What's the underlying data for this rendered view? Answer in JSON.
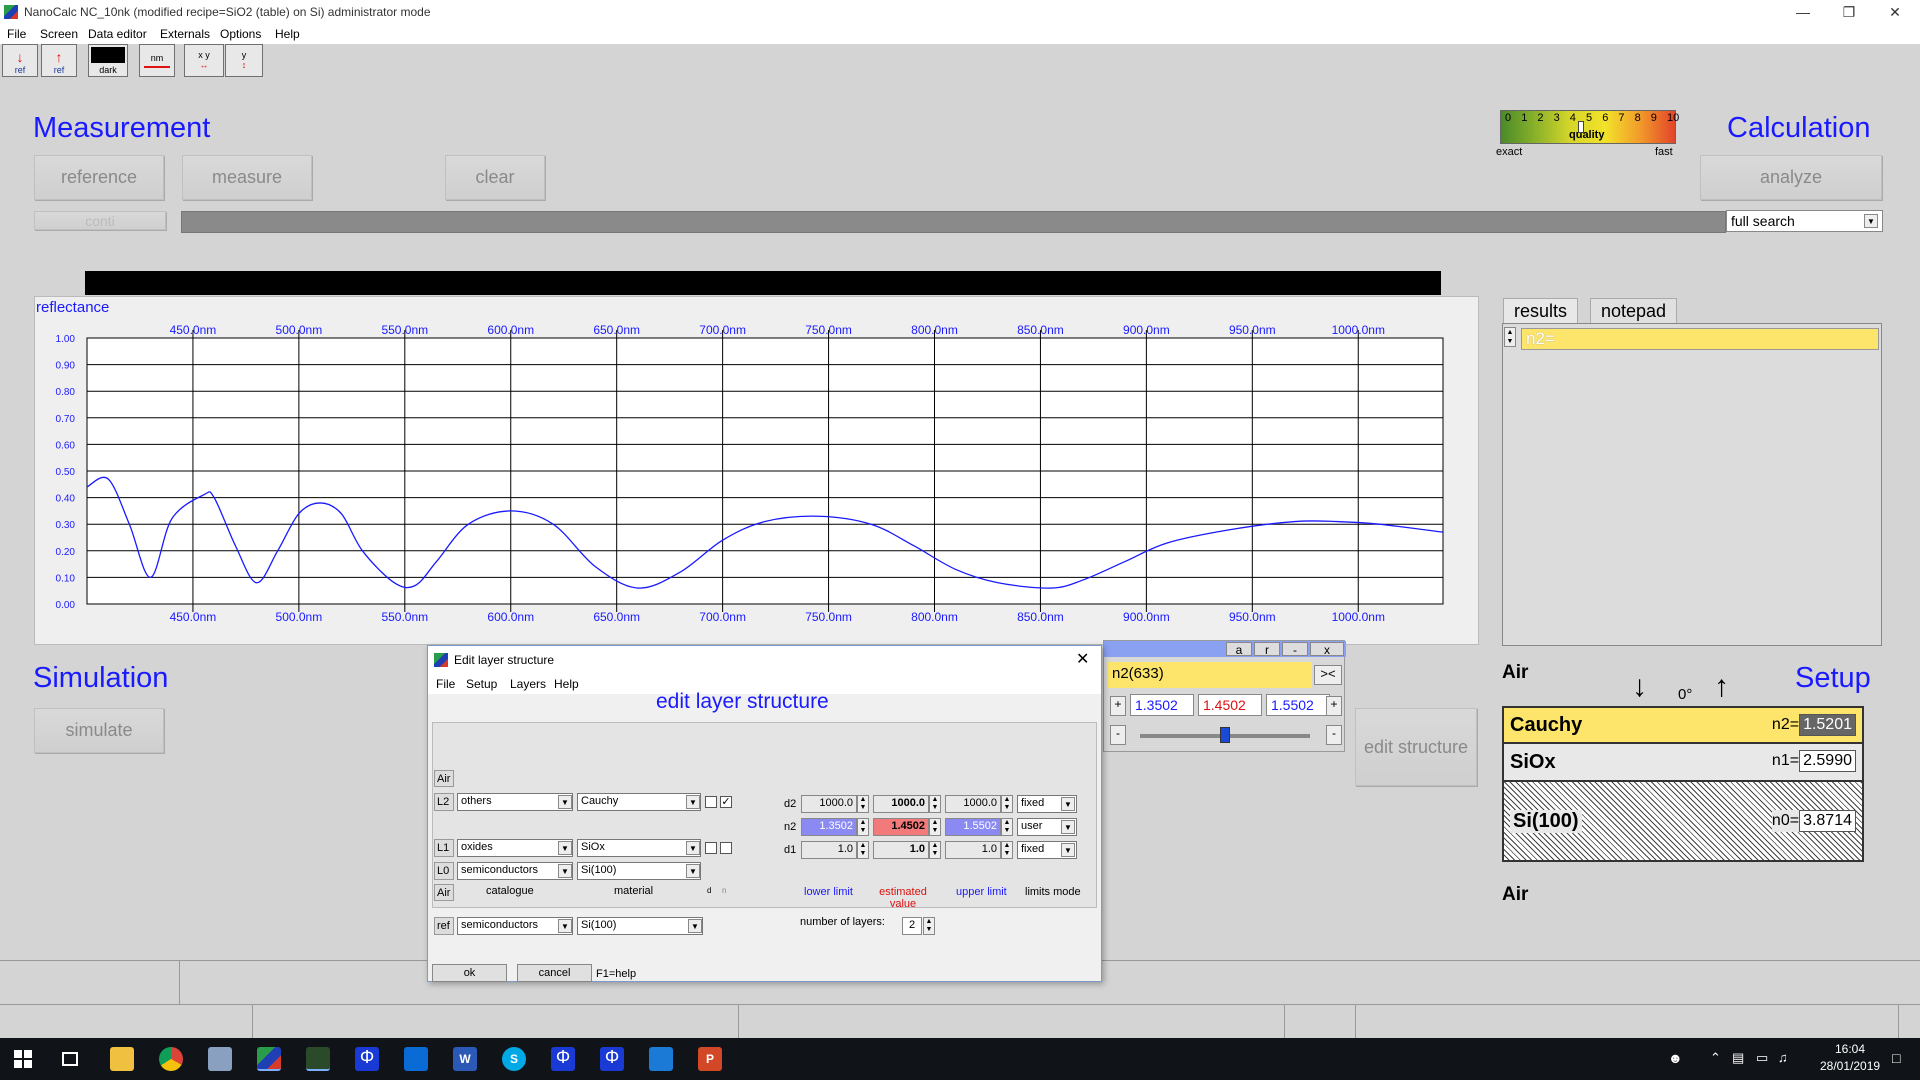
{
  "window": {
    "title": "NanoCalc NC_10nk   (modified recipe=SiO2 (table) on Si)   administrator mode"
  },
  "menu": [
    "File",
    "Screen",
    "Data editor",
    "Externals",
    "Options",
    "Help"
  ],
  "toolbar": {
    "ref1": "ref",
    "ref2": "ref",
    "dark": "dark",
    "nm": "nm",
    "xy": "x y",
    "y": "y"
  },
  "quality": {
    "ticks": [
      "0",
      "1",
      "2",
      "3",
      "4",
      "5",
      "6",
      "7",
      "8",
      "9",
      "10"
    ],
    "label": "quality",
    "left": "exact",
    "right": "fast",
    "value": 4.5
  },
  "measurement": {
    "title": "Measurement",
    "reference": "reference",
    "measure": "measure",
    "clear": "clear",
    "conti": "conti"
  },
  "calculation": {
    "title": "Calculation",
    "analyze": "analyze",
    "mode": "full search"
  },
  "chart": {
    "label": "reflectance"
  },
  "chart_data": {
    "type": "line",
    "title": "",
    "ylabel": "reflectance",
    "xlabel": "",
    "xticks": [
      "450.0nm",
      "500.0nm",
      "550.0nm",
      "600.0nm",
      "650.0nm",
      "700.0nm",
      "750.0nm",
      "800.0nm",
      "850.0nm",
      "900.0nm",
      "950.0nm",
      "1000.0nm"
    ],
    "yticks": [
      "1.00",
      "0.90",
      "0.80",
      "0.70",
      "0.60",
      "0.50",
      "0.40",
      "0.30",
      "0.20",
      "0.10",
      "0.00"
    ],
    "xlim": [
      400,
      1040
    ],
    "ylim": [
      0,
      1
    ],
    "grid": true,
    "series": [
      {
        "color": "#1a1aff",
        "x": [
          400,
          410,
          420,
          430,
          440,
          455,
          460,
          470,
          480,
          490,
          500,
          510,
          520,
          530,
          545,
          555,
          565,
          580,
          600,
          620,
          640,
          660,
          680,
          700,
          720,
          745,
          770,
          790,
          810,
          830,
          855,
          870,
          890,
          910,
          940,
          970,
          990,
          1010,
          1040
        ],
        "y": [
          0.44,
          0.47,
          0.3,
          0.1,
          0.32,
          0.41,
          0.4,
          0.22,
          0.08,
          0.2,
          0.34,
          0.38,
          0.34,
          0.2,
          0.08,
          0.07,
          0.16,
          0.3,
          0.35,
          0.3,
          0.14,
          0.06,
          0.12,
          0.24,
          0.31,
          0.33,
          0.3,
          0.22,
          0.13,
          0.08,
          0.06,
          0.09,
          0.16,
          0.23,
          0.28,
          0.31,
          0.31,
          0.3,
          0.27
        ]
      }
    ]
  },
  "results": {
    "tab1": "results",
    "tab2": "notepad",
    "line": "n2="
  },
  "simulation": {
    "title": "Simulation",
    "simulate": "simulate",
    "edit_structure": "edit structure"
  },
  "param_window": {
    "buttons": [
      "a",
      "r",
      "-",
      "x"
    ],
    "name": "n2(633)",
    "swap": "><",
    "plus": "+",
    "minus": "-",
    "low": "1.3502",
    "est": "1.4502",
    "high": "1.5502",
    "slider": 0.5
  },
  "setup": {
    "title": "Setup",
    "top": "Air",
    "bottom": "Air",
    "angle": "0°",
    "layers": [
      {
        "name": "Cauchy",
        "nlabel": "n2=",
        "n": "1.5201"
      },
      {
        "name": "SiOx",
        "nlabel": "n1=",
        "n": "2.5990"
      },
      {
        "name": "Si(100)",
        "nlabel": "n0=",
        "n": "3.8714"
      }
    ]
  },
  "dialog": {
    "title": "Edit layer structure",
    "menu": [
      "File",
      "Setup",
      "Layers",
      "Help"
    ],
    "heading": "edit layer structure",
    "air": "Air",
    "rows": [
      {
        "tag": "L2",
        "catalogue": "others",
        "material": "Cauchy"
      },
      {
        "tag": "L1",
        "catalogue": "oxides",
        "material": "SiOx"
      },
      {
        "tag": "L0",
        "catalogue": "semiconductors",
        "material": "Si(100)"
      }
    ],
    "col_catalogue": "catalogue",
    "col_material": "material",
    "col_d": "d",
    "col_n": "n",
    "ref_tag": "ref",
    "ref_catalogue": "semiconductors",
    "ref_material": "Si(100)",
    "params": [
      {
        "name": "d2",
        "low": "1000.0",
        "est": "1000.0",
        "high": "1000.0",
        "mode": "fixed"
      },
      {
        "name": "n2",
        "low": "1.3502",
        "est": "1.4502",
        "high": "1.5502",
        "mode": "user"
      },
      {
        "name": "d1",
        "low": "1.0",
        "est": "1.0",
        "high": "1.0",
        "mode": "fixed"
      }
    ],
    "lower": "lower limit",
    "estimated": "estimated value",
    "upper": "upper limit",
    "limits_mode": "limits mode",
    "nlayers_label": "number of layers:",
    "nlayers": "2",
    "ok": "ok",
    "cancel": "cancel",
    "help": "F1=help"
  },
  "clock": {
    "time": "16:04",
    "date": "28/01/2019"
  }
}
